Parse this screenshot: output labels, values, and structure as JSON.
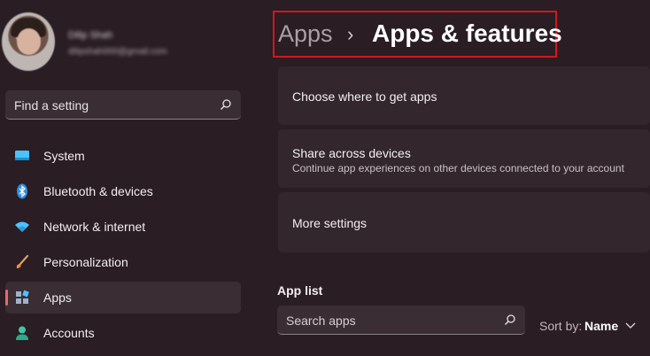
{
  "profile": {
    "name": "Dilip Shah",
    "email": "dilipshah000@gmail.com"
  },
  "sidebar": {
    "search_placeholder": "Find a setting",
    "items": [
      {
        "label": "System",
        "icon": "monitor-icon",
        "active": false
      },
      {
        "label": "Bluetooth & devices",
        "icon": "bluetooth-icon",
        "active": false
      },
      {
        "label": "Network & internet",
        "icon": "wifi-icon",
        "active": false
      },
      {
        "label": "Personalization",
        "icon": "brush-icon",
        "active": false
      },
      {
        "label": "Apps",
        "icon": "apps-icon",
        "active": true
      },
      {
        "label": "Accounts",
        "icon": "person-icon",
        "active": false
      }
    ]
  },
  "breadcrumb": {
    "parent": "Apps",
    "separator": "›",
    "current": "Apps & features"
  },
  "cards": [
    {
      "title": "Choose where to get apps",
      "subtitle": ""
    },
    {
      "title": "Share across devices",
      "subtitle": "Continue app experiences on other devices connected to your account"
    },
    {
      "title": "More settings",
      "subtitle": ""
    }
  ],
  "app_list": {
    "title": "App list",
    "search_placeholder": "Search apps",
    "sort_label": "Sort by:",
    "sort_value": "Name"
  },
  "colors": {
    "accent": "#e7686f",
    "highlight_border": "#d4161c",
    "background": "#2a1d24"
  }
}
